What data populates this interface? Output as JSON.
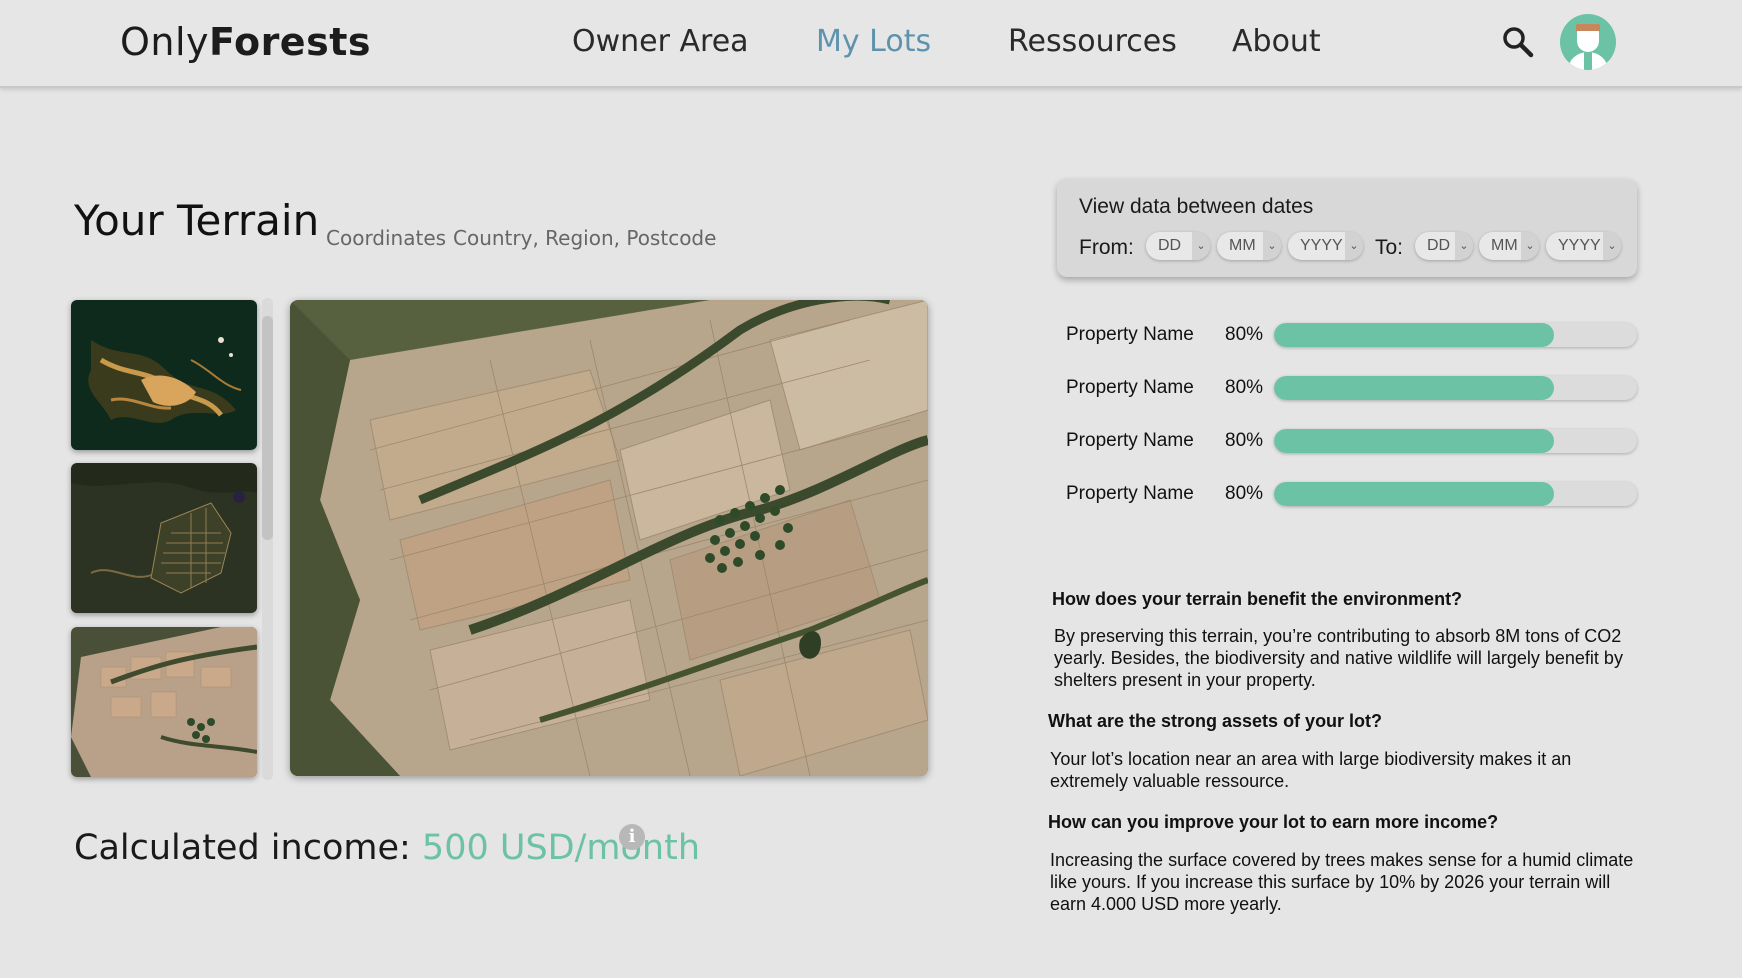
{
  "header": {
    "logo_light": "Only",
    "logo_bold": "Forests",
    "nav": [
      "Owner Area",
      "My Lots",
      "Ressources",
      "About"
    ],
    "active_nav": "My Lots",
    "search_icon": "search-icon",
    "avatar_icon": "user-avatar-icon"
  },
  "terrain": {
    "title": "Your Terrain",
    "coordinates_label": "Coordinates",
    "location_label": "Country, Region, Postcode"
  },
  "gallery": {
    "thumbnails": [
      "satellite-thumbnail-1",
      "satellite-thumbnail-2",
      "satellite-thumbnail-3"
    ],
    "main_image": "satellite-terrain-map"
  },
  "income": {
    "label": "Calculated income: ",
    "value": "500 USD/month",
    "info_glyph": "i"
  },
  "dates": {
    "title": "View data between dates",
    "from_label": "From:",
    "to_label": "To:",
    "from": {
      "day": "DD",
      "month": "MM",
      "year": "YYYY"
    },
    "to": {
      "day": "DD",
      "month": "MM",
      "year": "YYYY"
    }
  },
  "properties": [
    {
      "name": "Property Name",
      "percent_label": "80%",
      "value": 0.77
    },
    {
      "name": "Property Name",
      "percent_label": "80%",
      "value": 0.77
    },
    {
      "name": "Property Name",
      "percent_label": "80%",
      "value": 0.77
    },
    {
      "name": "Property Name",
      "percent_label": "80%",
      "value": 0.77
    }
  ],
  "qa": [
    {
      "q": "How does your terrain benefit the environment?",
      "a": "By preserving this terrain, you’re contributing to absorb 8M tons of CO2 yearly. Besides, the biodiversity and native wildlife will largely benefit by shelters present in your property."
    },
    {
      "q": "What are the strong assets of your lot?",
      "a": "Your lot’s location near an area with large biodiversity makes it an extremely valuable ressource."
    },
    {
      "q": "How can you improve your lot to earn more income?",
      "a": "Increasing the surface covered by trees makes sense for a humid climate like yours. If you increase this surface by 10% by 2026 your terrain will earn 4.000 USD more yearly."
    }
  ],
  "colors": {
    "accent": "#6cc2a4",
    "nav_active": "#5e93ae",
    "background": "#e5e5e5"
  }
}
